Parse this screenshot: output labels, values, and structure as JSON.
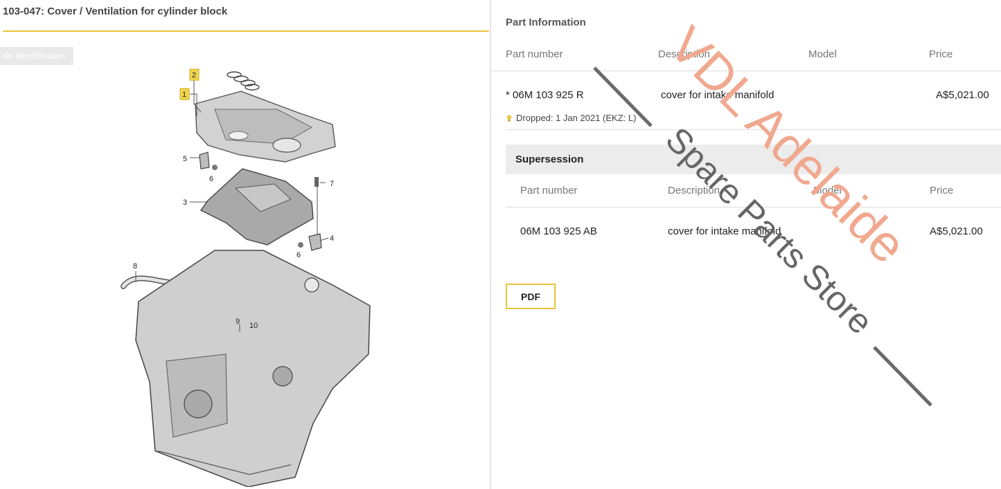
{
  "diagram": {
    "title": "103-047: Cover / Ventilation for cylinder block",
    "vehicle_id_button": "de identification",
    "callouts": [
      "1",
      "2",
      "3",
      "4",
      "5",
      "6",
      "6",
      "7",
      "8",
      "9",
      "10"
    ]
  },
  "part_info": {
    "section_title": "Part Information",
    "columns": {
      "part_number": "Part number",
      "description": "Description",
      "model": "Model",
      "price": "Price"
    },
    "row": {
      "part_number": "* 06M 103 925 R",
      "description": "cover for intake manifold",
      "model": "",
      "price": "A$5,021.00",
      "note": "Dropped: 1 Jan 2021 (EKZ: L)"
    }
  },
  "supersession": {
    "title": "Supersession",
    "columns": {
      "part_number": "Part number",
      "description": "Description",
      "model": "Model",
      "price": "Price"
    },
    "row": {
      "part_number": "06M 103 925 AB",
      "description": "cover for intake manifold",
      "model": "",
      "price": "A$5,021.00"
    }
  },
  "pdf_button": "PDF",
  "watermark": {
    "brand": "VDL Adelaide",
    "tagline": "Spare Parts Store",
    "brand_color": "#f0a88f",
    "tagline_color": "#666666"
  },
  "colors": {
    "accent": "#e8c33a"
  }
}
